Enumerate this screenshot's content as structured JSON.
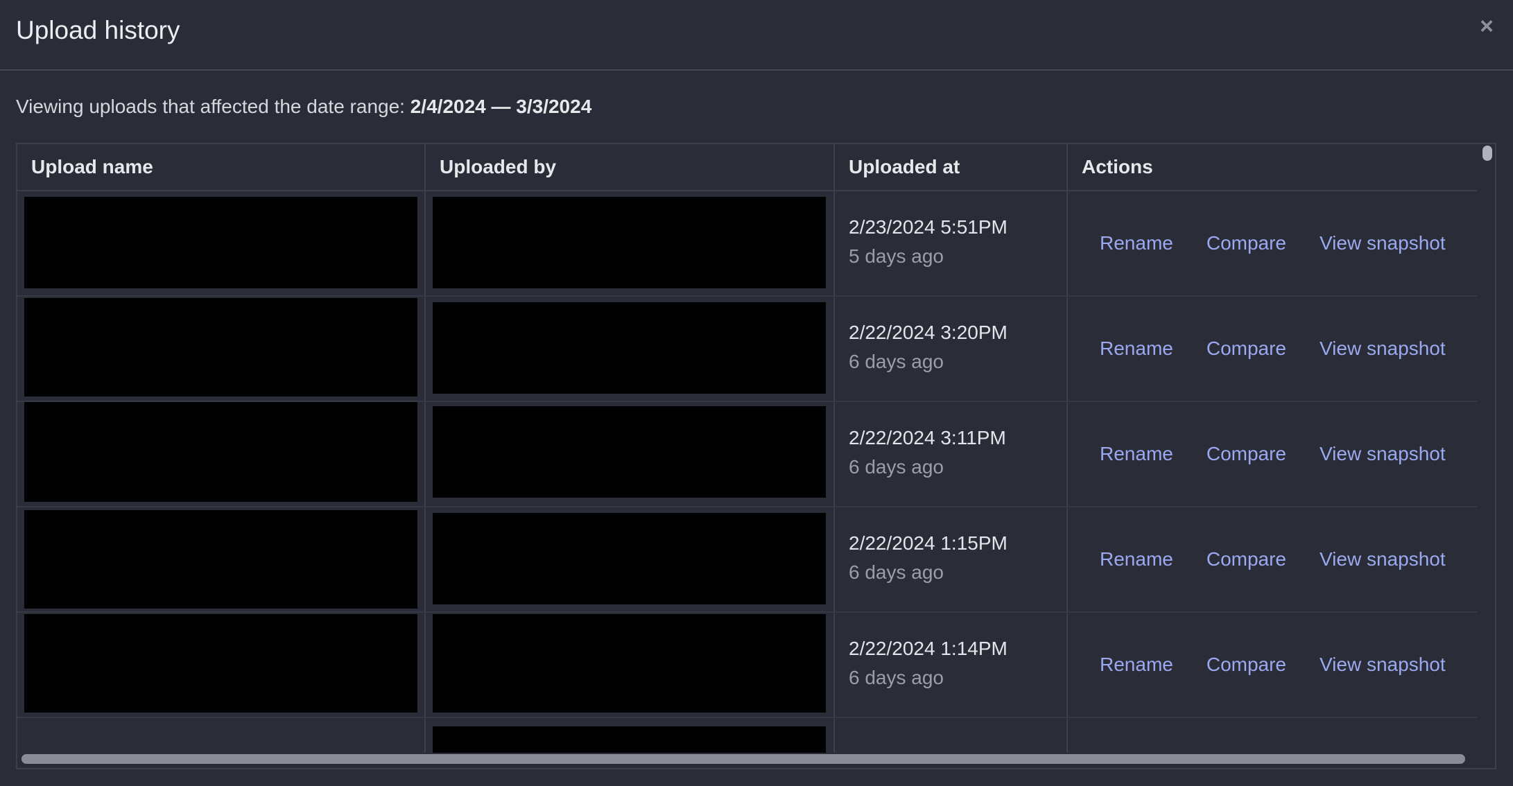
{
  "modal": {
    "title": "Upload history",
    "close_icon": "close-icon",
    "range_prefix": "Viewing uploads that affected the date range: ",
    "range_value": "2/4/2024 — 3/3/2024"
  },
  "table": {
    "columns": [
      "Upload name",
      "Uploaded by",
      "Uploaded at",
      "Actions"
    ],
    "rows": [
      {
        "uploaded_at": "2/23/2024 5:51PM",
        "relative": "5 days ago"
      },
      {
        "uploaded_at": "2/22/2024 3:20PM",
        "relative": "6 days ago"
      },
      {
        "uploaded_at": "2/22/2024 3:11PM",
        "relative": "6 days ago"
      },
      {
        "uploaded_at": "2/22/2024 1:15PM",
        "relative": "6 days ago"
      },
      {
        "uploaded_at": "2/22/2024 1:14PM",
        "relative": "6 days ago"
      }
    ],
    "actions": {
      "rename": "Rename",
      "compare": "Compare",
      "view_snapshot": "View snapshot"
    }
  }
}
